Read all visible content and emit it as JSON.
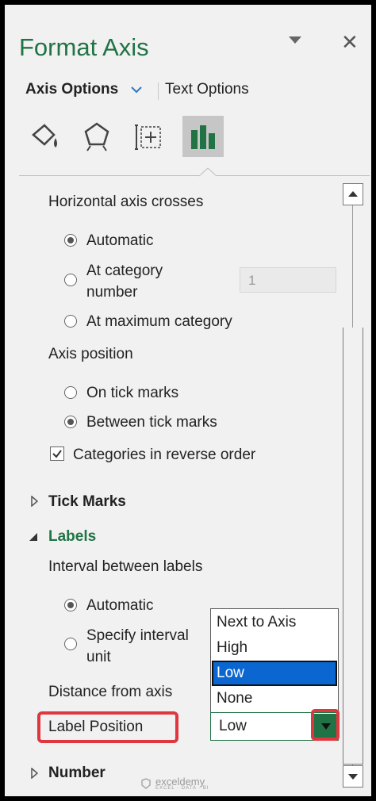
{
  "panel": {
    "title": "Format Axis",
    "tabs": {
      "axis_options": "Axis Options",
      "text_options": "Text Options"
    },
    "icons": [
      "fill-line-icon",
      "effects-pentagon-icon",
      "size-properties-icon",
      "axis-options-chart-icon"
    ],
    "selected_icon": "axis-options-chart-icon"
  },
  "horizontal_axis_crosses": {
    "heading": "Horizontal axis crosses",
    "options": [
      "Automatic",
      "At category",
      "number",
      "At maximum category"
    ],
    "category_number_value": "1",
    "selected": "Automatic"
  },
  "axis_position": {
    "heading": "Axis position",
    "options": [
      "On tick marks",
      "Between tick marks"
    ],
    "selected": "Between tick marks",
    "reverse_order_label": "Categories in reverse order",
    "reverse_order_checked": true
  },
  "tick_marks": {
    "label": "Tick Marks"
  },
  "labels": {
    "label": "Labels",
    "interval_heading": "Interval between labels",
    "interval_options": [
      "Automatic",
      "Specify interval",
      "unit"
    ],
    "interval_selected": "Automatic",
    "distance_label": "Distance from axis",
    "position_label": "Label Position",
    "position_value": "Low",
    "position_options": [
      "Next to Axis",
      "High",
      "Low",
      "None"
    ],
    "position_selected": "Low"
  },
  "number": {
    "label": "Number"
  },
  "watermark": {
    "name": "exceldemy",
    "tagline": "EXCEL · DATA · BI"
  },
  "colors": {
    "accent": "#217346",
    "highlight": "#e0363f",
    "selection": "#0a66d1"
  }
}
